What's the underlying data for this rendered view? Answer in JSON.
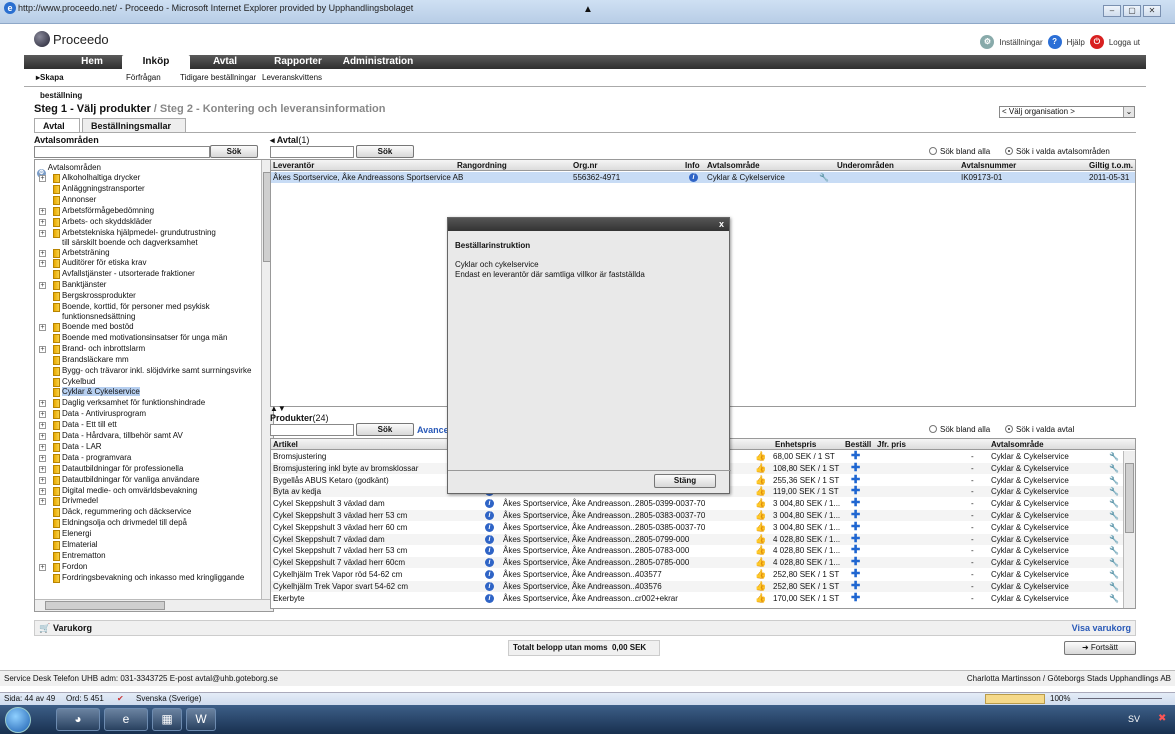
{
  "browser": {
    "title": "http://www.proceedo.net/ - Proceedo - Microsoft Internet Explorer provided by Upphandlingsbolaget",
    "win_min": "–",
    "win_max": "▢",
    "win_close": "✕"
  },
  "app": {
    "logo": "Proceedo",
    "links": {
      "settings": "Inställningar",
      "help": "Hjälp",
      "logout": "Logga ut"
    },
    "nav": [
      {
        "label": "Hem",
        "active": false
      },
      {
        "label": "Inköp",
        "active": true
      },
      {
        "label": "Avtal",
        "active": false
      },
      {
        "label": "Rapporter",
        "active": false
      },
      {
        "label": "Administration",
        "active": false
      }
    ],
    "subnav": {
      "active": "Skapa beställning",
      "items": [
        "Förfrågan",
        "Tidigare beställningar",
        "Leveranskvittens"
      ]
    },
    "steps": {
      "step1": "Steg 1 - Välj produkter",
      "sep": " / ",
      "step2": "Steg 2 - Kontering och leveransinformation"
    },
    "org_select": "< Välj organisation >",
    "tabs": [
      "Avtal",
      "Beställningsmallar"
    ]
  },
  "left": {
    "title": "Avtalsområden",
    "search_btn": "Sök",
    "root": "Avtalsområden",
    "items": [
      {
        "label": "Alkoholhaltiga drycker",
        "expand": true
      },
      {
        "label": "Anläggningstransporter",
        "expand": false
      },
      {
        "label": "Annonser",
        "expand": false
      },
      {
        "label": "Arbetsförmågebedömning",
        "expand": true
      },
      {
        "label": "Arbets- och skyddskläder",
        "expand": true
      },
      {
        "label": "Arbetstekniska hjälpmedel- grundutrustning",
        "label2": "till särskilt boende och dagverksamhet",
        "expand": true
      },
      {
        "label": "Arbetsträning",
        "expand": true
      },
      {
        "label": "Auditörer för etiska krav",
        "expand": true
      },
      {
        "label": "Avfallstjänster - utsorterade fraktioner",
        "expand": false
      },
      {
        "label": "Banktjänster",
        "expand": true
      },
      {
        "label": "Bergskrossprodukter",
        "expand": false
      },
      {
        "label": "Boende, korttid, för personer med psykisk",
        "label2": "funktionsnedsättning",
        "expand": false
      },
      {
        "label": "Boende med bostöd",
        "expand": true
      },
      {
        "label": "Boende med motivationsinsatser för unga män",
        "expand": false
      },
      {
        "label": "Brand- och inbrottslarm",
        "expand": true
      },
      {
        "label": "Brandsläckare mm",
        "expand": false
      },
      {
        "label": "Bygg- och trävaror inkl. slöjdvirke samt surrningsvirke",
        "expand": false
      },
      {
        "label": "Cykelbud",
        "expand": false
      },
      {
        "label": "Cyklar & Cykelservice",
        "expand": false,
        "selected": true
      },
      {
        "label": "Daglig verksamhet för funktionshindrade",
        "expand": true
      },
      {
        "label": "Data - Antivirusprogram",
        "expand": true
      },
      {
        "label": "Data - Ett till ett",
        "expand": true
      },
      {
        "label": "Data - Hårdvara, tillbehör samt AV",
        "expand": true
      },
      {
        "label": "Data - LAR",
        "expand": true
      },
      {
        "label": "Data - programvara",
        "expand": true
      },
      {
        "label": "Datautbildningar för professionella",
        "expand": true
      },
      {
        "label": "Datautbildningar för vanliga användare",
        "expand": true
      },
      {
        "label": "Digital medie- och omvärldsbevakning",
        "expand": true
      },
      {
        "label": "Drivmedel",
        "expand": true
      },
      {
        "label": "Däck, regummering och däckservice",
        "expand": false
      },
      {
        "label": "Eldningsolja och drivmedel till depå",
        "expand": false
      },
      {
        "label": "Elenergi",
        "expand": false
      },
      {
        "label": "Elmaterial",
        "expand": false
      },
      {
        "label": "Entrematton",
        "expand": false
      },
      {
        "label": "Fordon",
        "expand": true
      },
      {
        "label": "Fordringsbevakning och inkasso med kringliggande",
        "expand": false
      }
    ]
  },
  "avtal": {
    "title": "Avtal",
    "count": "(1)",
    "search_btn": "Sök",
    "radio_all": "Sök bland alla",
    "radio_selected": "Sök i valda avtalsområden",
    "columns": [
      "Leverantör",
      "Rangordning",
      "Org.nr",
      "Info",
      "Avtalsområde",
      "Underområden",
      "Avtalsnummer",
      "Giltig t.o.m."
    ],
    "row": {
      "leverantor": "Åkes Sportservice, Åke Andreassons Sportservice AB",
      "orgnr": "556362-4971",
      "avtalsomrade": "Cyklar & Cykelservice",
      "avtalsnummer": "IK09173-01",
      "giltig": "2011-05-31"
    }
  },
  "produkter": {
    "title": "Produkter",
    "count": "(24)",
    "search_btn": "Sök",
    "advanced": "Avancerad",
    "radio_all": "Sök bland alla",
    "radio_selected": "Sök i valda avtal",
    "columns": [
      "Artikel",
      "Enhetspris",
      "Beställ",
      "Jfr. pris",
      "Avtalsområde"
    ],
    "rows": [
      {
        "artikel": "Bromsjustering",
        "lev": "",
        "art": "",
        "pris": "68,00 SEK / 1 ST",
        "jfr": "-",
        "omr": "Cyklar & Cykelservice"
      },
      {
        "artikel": "Bromsjustering inkl byte av bromsklossar",
        "lev": "",
        "art": "",
        "pris": "108,80 SEK / 1 ST",
        "jfr": "-",
        "omr": "Cyklar & Cykelservice"
      },
      {
        "artikel": "Bygellås ABUS Ketaro (godkänt)",
        "lev": "",
        "art": "",
        "pris": "255,36 SEK / 1 ST",
        "jfr": "-",
        "omr": "Cyklar & Cykelservice"
      },
      {
        "artikel": "Byta av kedja",
        "lev": "",
        "art": "",
        "pris": "119,00 SEK / 1 ST",
        "jfr": "-",
        "omr": "Cyklar & Cykelservice"
      },
      {
        "artikel": "Cykel Skeppshult 3 växlad dam",
        "lev": "Åkes Sportservice, Åke Andreasson...",
        "art": "2805-0399-0037-70",
        "pris": "3 004,80 SEK / 1...",
        "jfr": "-",
        "omr": "Cyklar & Cykelservice"
      },
      {
        "artikel": "Cykel Skeppshult 3 växlad herr 53 cm",
        "lev": "Åkes Sportservice, Åke Andreasson...",
        "art": "2805-0383-0037-70",
        "pris": "3 004,80 SEK / 1...",
        "jfr": "-",
        "omr": "Cyklar & Cykelservice"
      },
      {
        "artikel": "Cykel Skeppshult 3 växlad herr 60 cm",
        "lev": "Åkes Sportservice, Åke Andreasson...",
        "art": "2805-0385-0037-70",
        "pris": "3 004,80 SEK / 1...",
        "jfr": "-",
        "omr": "Cyklar & Cykelservice"
      },
      {
        "artikel": "Cykel Skeppshult 7 växlad dam",
        "lev": "Åkes Sportservice, Åke Andreasson...",
        "art": "2805-0799-000",
        "pris": "4 028,80 SEK / 1...",
        "jfr": "-",
        "omr": "Cyklar & Cykelservice"
      },
      {
        "artikel": "Cykel Skeppshult 7 växlad herr 53 cm",
        "lev": "Åkes Sportservice, Åke Andreasson...",
        "art": "2805-0783-000",
        "pris": "4 028,80 SEK / 1...",
        "jfr": "-",
        "omr": "Cyklar & Cykelservice"
      },
      {
        "artikel": "Cykel Skeppshult 7 växlad herr 60cm",
        "lev": "Åkes Sportservice, Åke Andreasson...",
        "art": "2805-0785-000",
        "pris": "4 028,80 SEK / 1...",
        "jfr": "-",
        "omr": "Cyklar & Cykelservice"
      },
      {
        "artikel": "Cykelhjälm Trek Vapor röd 54-62 cm",
        "lev": "Åkes Sportservice, Åke Andreasson...",
        "art": "403577",
        "pris": "252,80 SEK / 1 ST",
        "jfr": "-",
        "omr": "Cyklar & Cykelservice"
      },
      {
        "artikel": "Cykelhjälm Trek Vapor svart 54-62 cm",
        "lev": "Åkes Sportservice, Åke Andreasson...",
        "art": "403576",
        "pris": "252,80 SEK / 1 ST",
        "jfr": "-",
        "omr": "Cyklar & Cykelservice"
      },
      {
        "artikel": "Ekerbyte",
        "lev": "Åkes Sportservice, Åke Andreasson...",
        "art": "cr002+ekrar",
        "pris": "170,00 SEK / 1 ST",
        "jfr": "-",
        "omr": "Cyklar & Cykelservice"
      }
    ]
  },
  "modal": {
    "title": "Beställarinstruktion",
    "line1": "Cyklar och cykelservice",
    "line2": "Endast en leverantör där samtliga villkor är fastställda",
    "close_btn": "Stäng",
    "x": "x"
  },
  "cart": {
    "title": "Varukorg",
    "show": "Visa varukorg",
    "total_label": "Totalt belopp utan moms",
    "total_value": "0,00 SEK",
    "next_btn": "Fortsätt"
  },
  "footer": {
    "left": "Service Desk Telefon UHB adm: 031-3343725 E-post avtal@uhb.goteborg.se",
    "right": "Charlotta Martinsson / Göteborgs Stads Upphandlings AB"
  },
  "statusbar": {
    "page": "Sida: 44 av 49",
    "words": "Ord: 5 451",
    "lang": "Svenska (Sverige)",
    "zoom": "100%"
  },
  "taskbar": {
    "tray_lang": "SV"
  }
}
